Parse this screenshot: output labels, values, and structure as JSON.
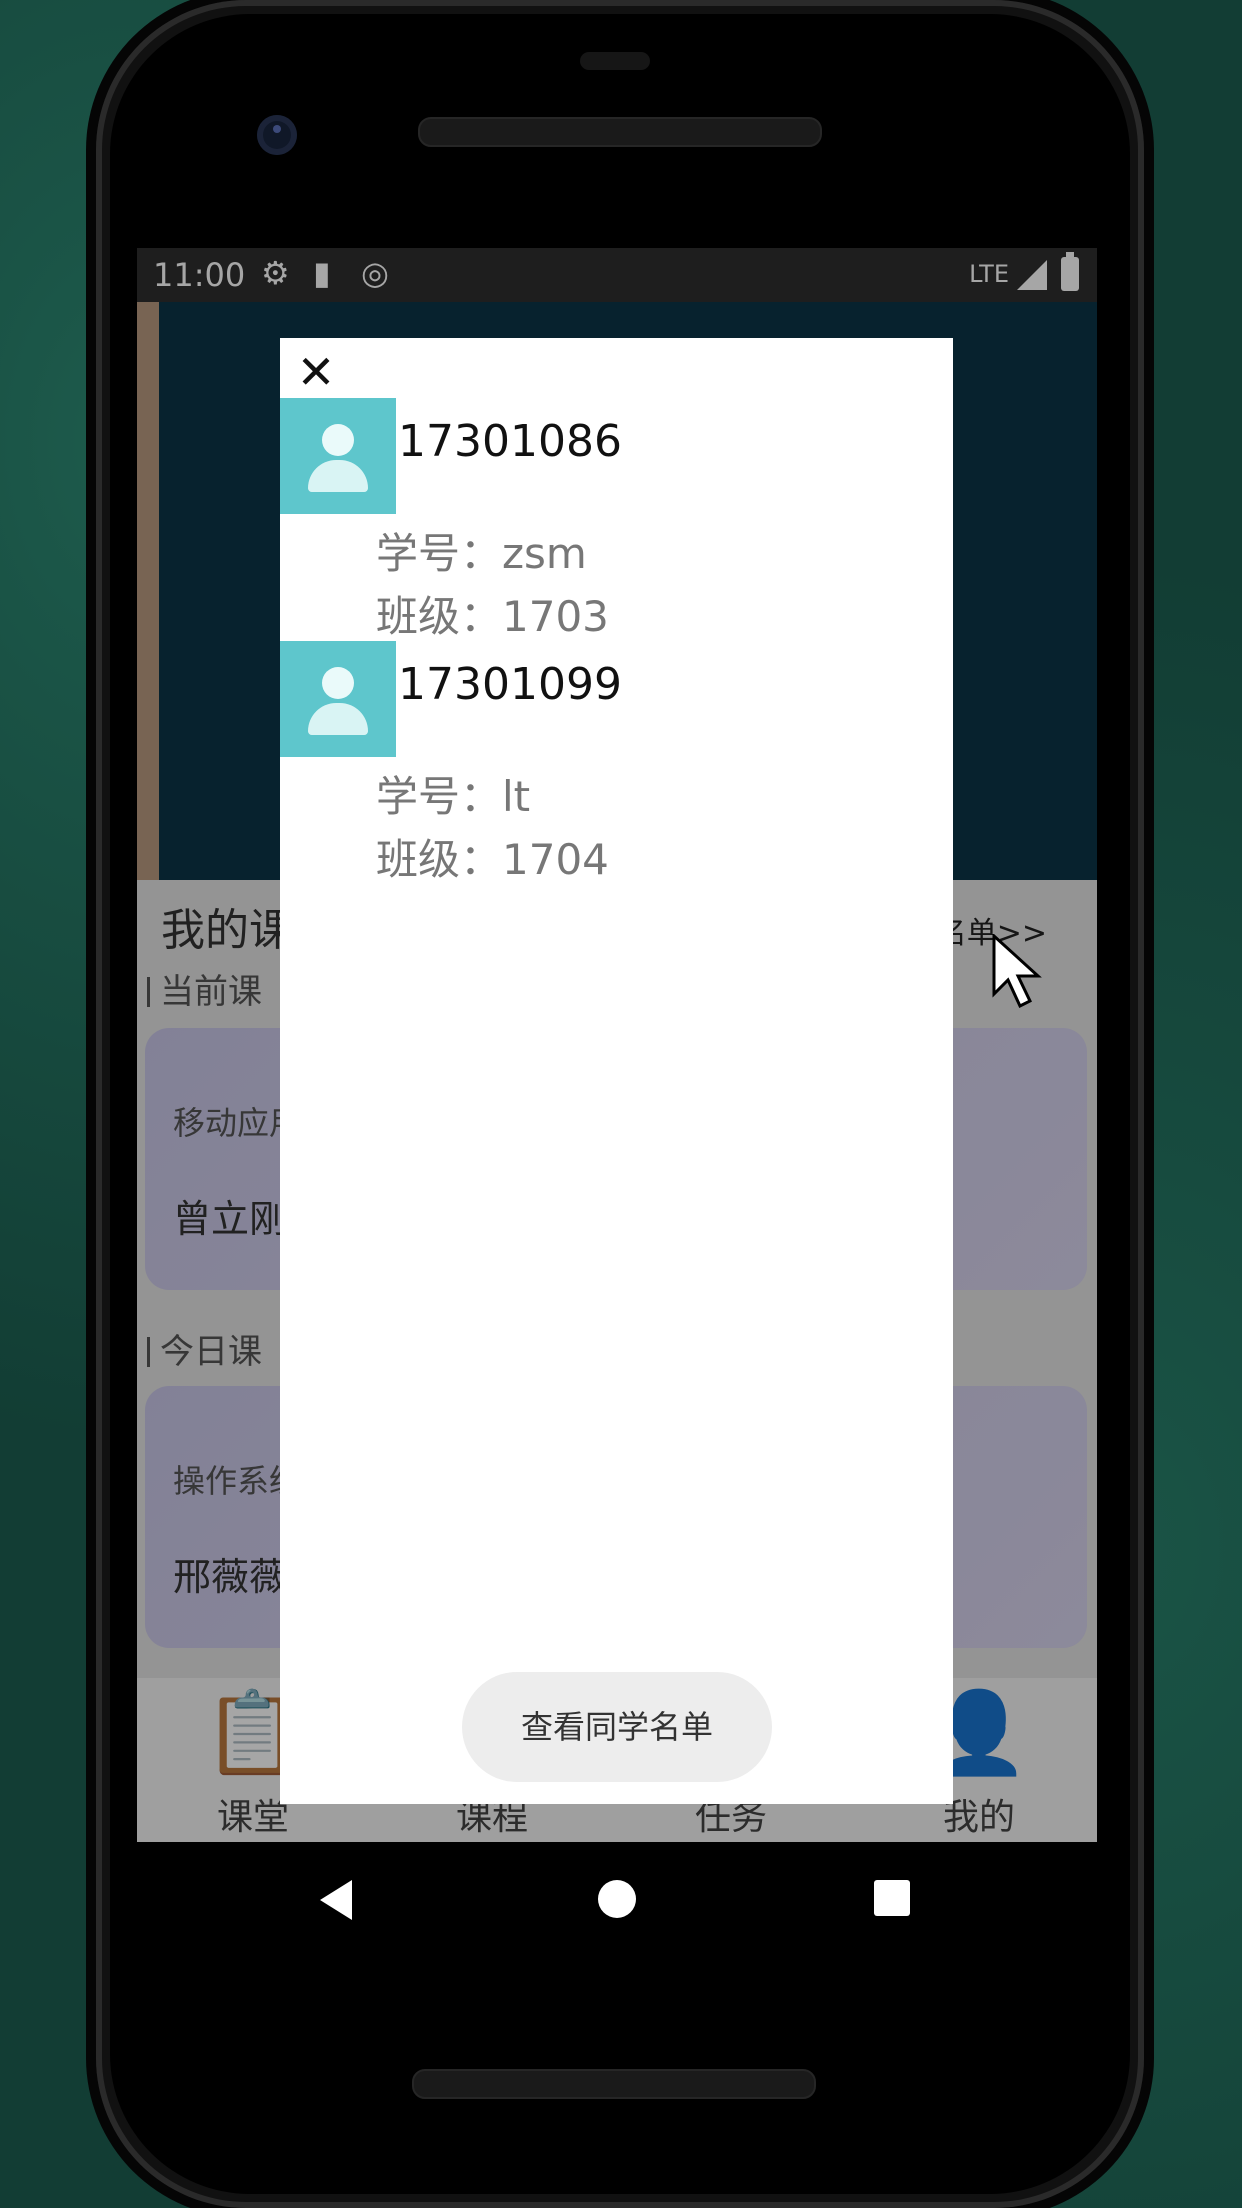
{
  "status_bar": {
    "time": "11:00",
    "network": "LTE",
    "icons": [
      "gear-icon",
      "sd-card-icon",
      "sync-icon",
      "signal-icon",
      "battery-icon"
    ]
  },
  "background_app": {
    "section_title": "我的课",
    "list_link": "名单>>",
    "current_section": "当前课",
    "current_course": {
      "title": "移动应用",
      "teacher": "曾立刚"
    },
    "today_section": "今日课",
    "today_course": {
      "title": "操作系统",
      "teacher": "邢薇薇"
    },
    "bottom_nav": [
      {
        "label": "课堂",
        "icon": "clipboard-icon"
      },
      {
        "label": "课程",
        "icon": "book-icon"
      },
      {
        "label": "任务",
        "icon": "task-icon"
      },
      {
        "label": "我的",
        "icon": "person-icon"
      }
    ]
  },
  "dialog": {
    "close_icon": "close-icon",
    "students": [
      {
        "id": "17301086",
        "student_no": "学号：zsm",
        "class": "班级：1703"
      },
      {
        "id": "17301099",
        "student_no": "学号：lt",
        "class": "班级：1704"
      }
    ],
    "action_button": "查看同学名单"
  },
  "colors": {
    "avatar_bg": "#5ec6cc",
    "dialog_bg": "#ffffff",
    "status_bar": "#2f2f2f"
  }
}
